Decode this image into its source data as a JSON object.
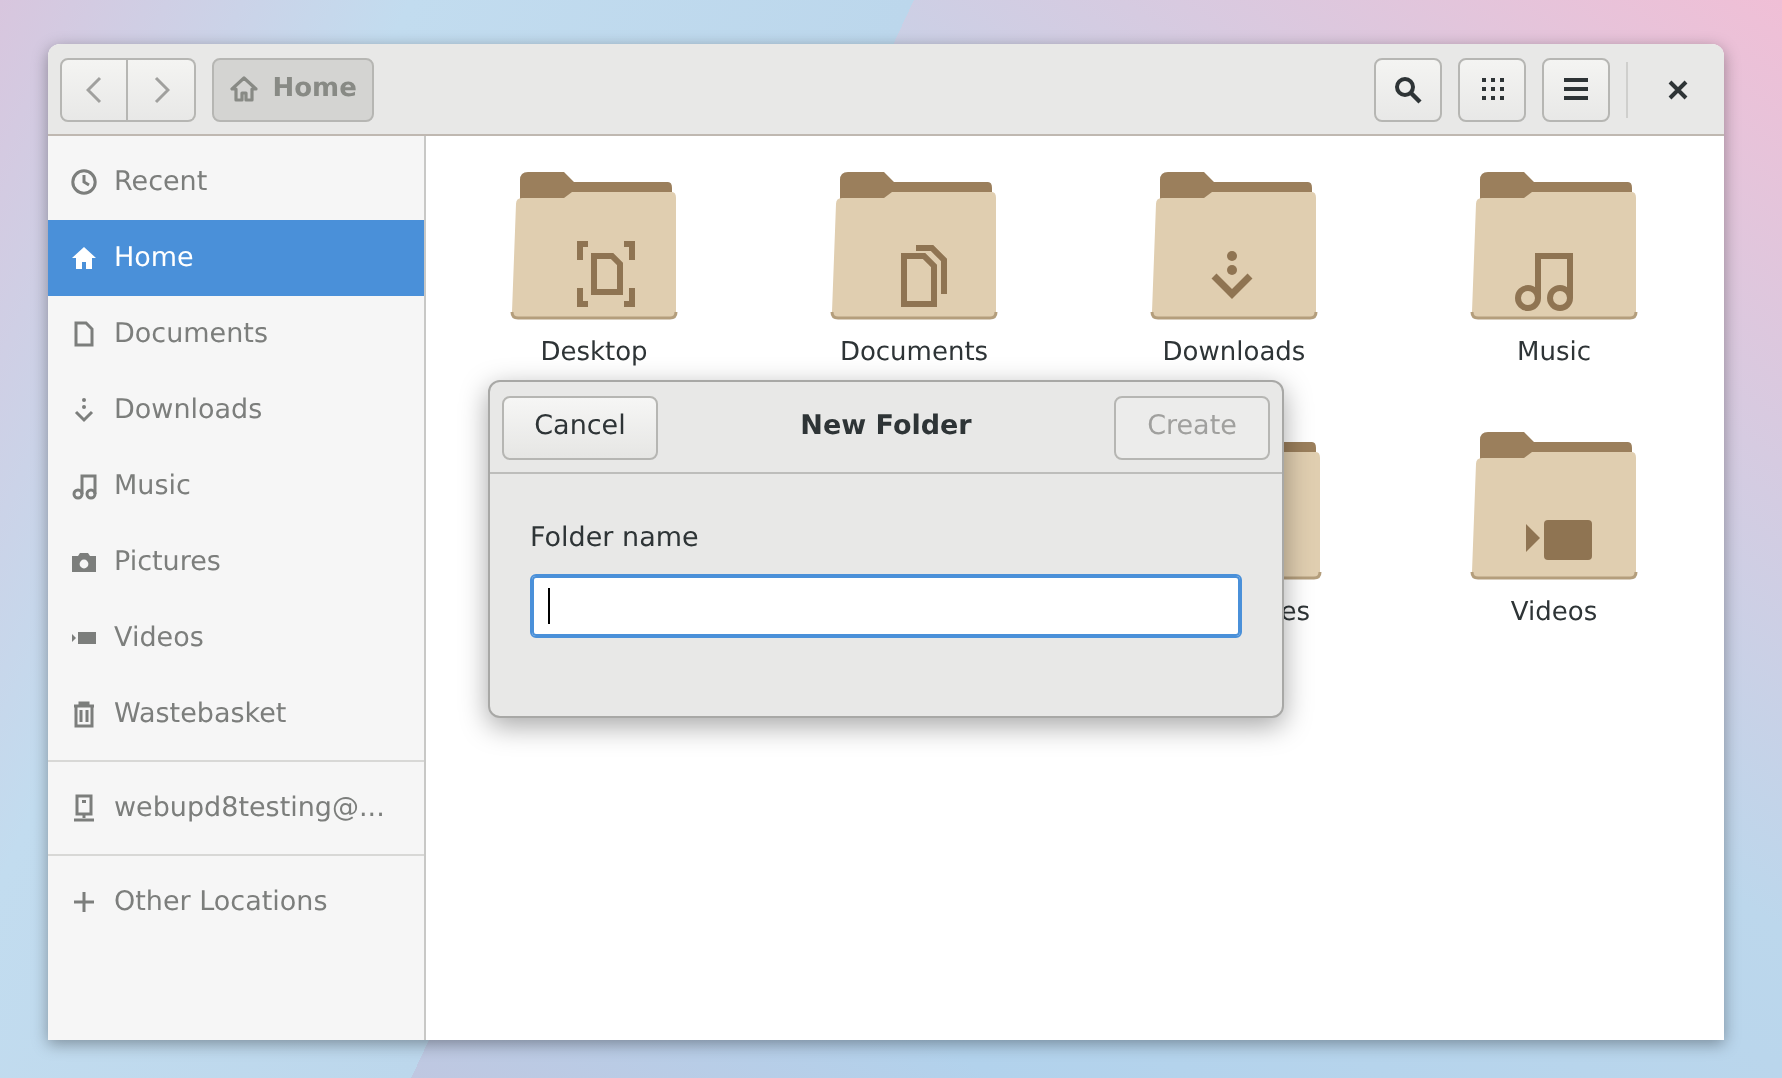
{
  "window": {
    "nav_back": {
      "disabled": true
    },
    "nav_forward": {
      "disabled": true
    },
    "path_button": {
      "label": "Home",
      "selected": true
    }
  },
  "sidebar": {
    "sections": [
      {
        "items": [
          {
            "label": "Recent",
            "selected": false
          },
          {
            "label": "Home",
            "selected": true
          },
          {
            "label": "Documents",
            "selected": false
          },
          {
            "label": "Downloads",
            "selected": false
          },
          {
            "label": "Music",
            "selected": false
          },
          {
            "label": "Pictures",
            "selected": false
          },
          {
            "label": "Videos",
            "selected": false
          },
          {
            "label": "Wastebasket",
            "selected": false
          }
        ]
      },
      {
        "items": [
          {
            "label": "webupd8testing@...",
            "selected": false
          }
        ]
      },
      {
        "items": [
          {
            "label": "Other Locations",
            "selected": false
          }
        ]
      }
    ]
  },
  "folders": [
    {
      "kind": "folder",
      "label": "Desktop"
    },
    {
      "kind": "folder",
      "label": "Documents"
    },
    {
      "kind": "folder",
      "label": "Downloads"
    },
    {
      "kind": "folder",
      "label": "Music"
    },
    {
      "kind": "partial",
      "label": "es"
    },
    {
      "kind": "folder",
      "label": "Videos"
    }
  ],
  "dialog": {
    "title": "New Folder",
    "cancel": {
      "label": "Cancel",
      "disabled": false
    },
    "create": {
      "label": "Create",
      "disabled": true
    },
    "field_label": "Folder name",
    "field": {
      "focused": true
    }
  }
}
